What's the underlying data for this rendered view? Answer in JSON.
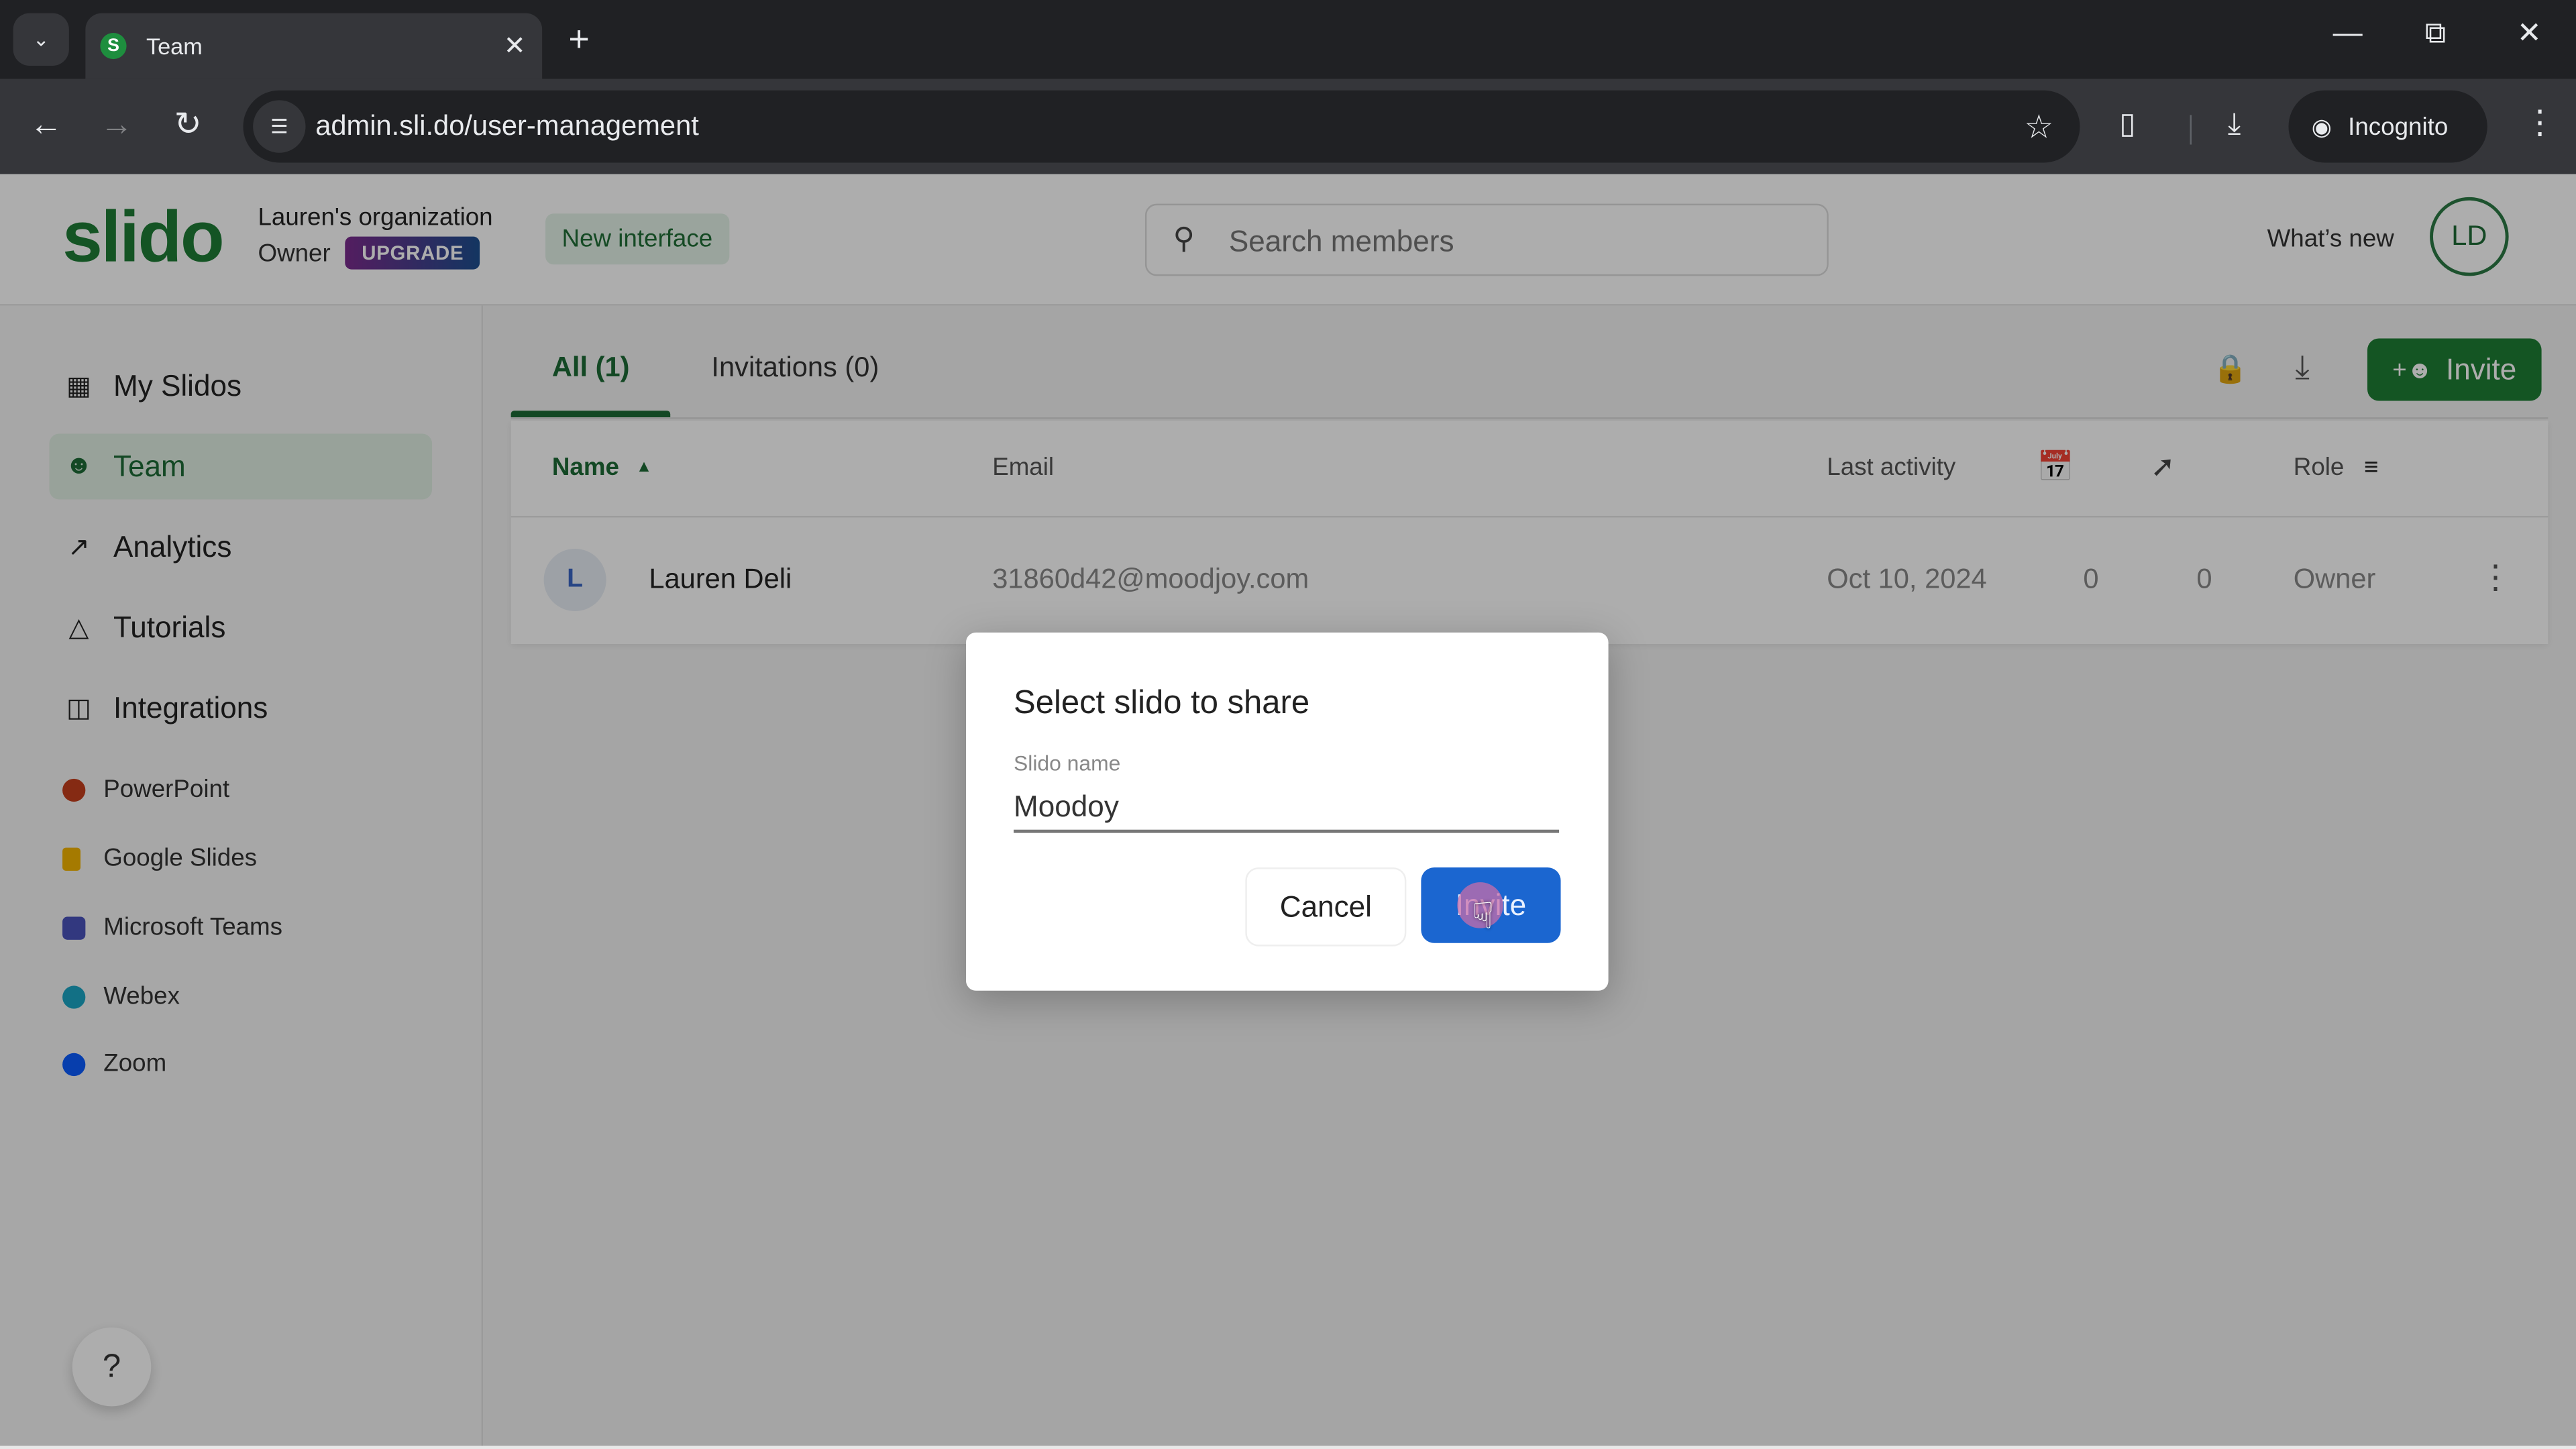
{
  "browser": {
    "tab_title": "Team",
    "tab_favicon_letter": "S",
    "url": "admin.sli.do/user-management",
    "profile_label": "Incognito"
  },
  "header": {
    "logo": "slido",
    "org_name": "Lauren's organization",
    "user_role": "Owner",
    "upgrade_label": "UPGRADE",
    "new_interface_label": "New interface",
    "search_placeholder": "Search members",
    "search_value": "",
    "whats_new_label": "What’s new",
    "avatar_initials": "LD"
  },
  "sidebar": {
    "nav": [
      {
        "label": "My Slidos",
        "icon": "calendar-grid-icon",
        "active": false
      },
      {
        "label": "Team",
        "icon": "people-icon",
        "active": true
      },
      {
        "label": "Analytics",
        "icon": "trend-up-icon",
        "active": false
      },
      {
        "label": "Tutorials",
        "icon": "graduation-cap-icon",
        "active": false
      },
      {
        "label": "Integrations",
        "icon": "puzzle-icon",
        "active": false
      }
    ],
    "integrations": [
      {
        "label": "PowerPoint",
        "color": "#c43e1c"
      },
      {
        "label": "Google Slides",
        "color": "#f4b400"
      },
      {
        "label": "Microsoft Teams",
        "color": "#4b53bc"
      },
      {
        "label": "Webex",
        "color": "#1ba6c4"
      },
      {
        "label": "Zoom",
        "color": "#0b5cff"
      }
    ],
    "help_label": "?"
  },
  "main": {
    "tabs": [
      {
        "label": "All (1)",
        "active": true
      },
      {
        "label": "Invitations (0)",
        "active": false
      }
    ],
    "invite_button_label": "Invite",
    "table": {
      "columns": [
        "Name",
        "Email",
        "Last activity",
        "Role"
      ],
      "sort_column": "Name",
      "sort_direction": "ascending",
      "rows": [
        {
          "initial": "L",
          "name": "Lauren Deli",
          "email": "31860d42@moodjoy.com",
          "last_activity": "Oct 10, 2024",
          "slidos_count": "0",
          "analytics_count": "0",
          "role": "Owner"
        }
      ]
    }
  },
  "dialog": {
    "title": "Select slido to share",
    "field_label": "Slido name",
    "field_value": "Moodoy",
    "cancel_label": "Cancel",
    "confirm_label": "Invite"
  },
  "colors": {
    "brand_green": "#1e7d36",
    "primary_blue": "#1b66d0",
    "active_nav_bg": "#e1efe4"
  }
}
